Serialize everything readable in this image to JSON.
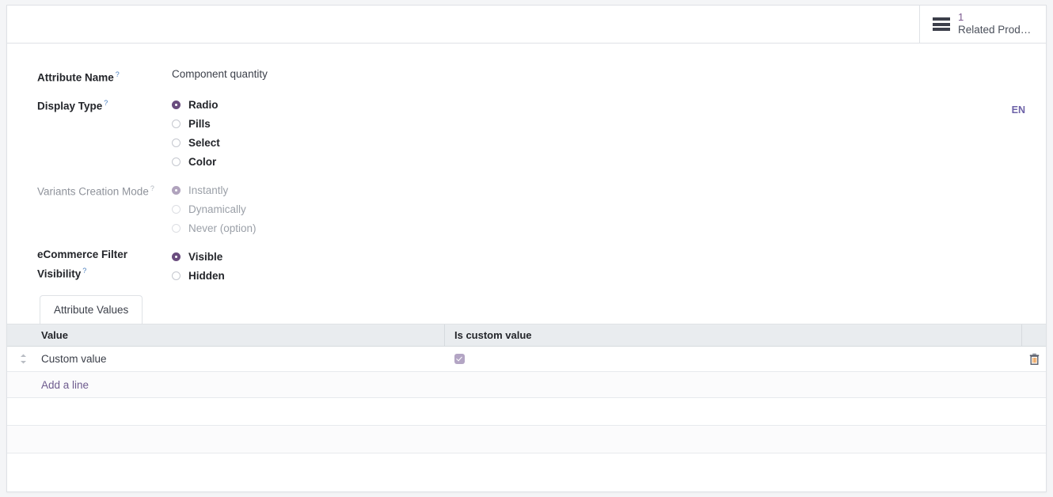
{
  "statusbar": {
    "related_products_button": {
      "icon": "hamburger-list-icon",
      "count": "1",
      "label": "Related Prod…"
    }
  },
  "form": {
    "attribute_name": {
      "label": "Attribute Name",
      "help_marker": "?",
      "value": "Component quantity"
    },
    "language_badge": "EN",
    "display_type": {
      "label": "Display Type",
      "help_marker": "?",
      "selected": "Radio",
      "options": [
        {
          "label": "Radio",
          "checked": true
        },
        {
          "label": "Pills",
          "checked": false
        },
        {
          "label": "Select",
          "checked": false
        },
        {
          "label": "Color",
          "checked": false
        }
      ]
    },
    "variants_creation_mode": {
      "label": "Variants Creation Mode",
      "help_marker": "?",
      "disabled": true,
      "selected": "Instantly",
      "options": [
        {
          "label": "Instantly",
          "checked": true
        },
        {
          "label": "Dynamically",
          "checked": false
        },
        {
          "label": "Never (option)",
          "checked": false
        }
      ]
    },
    "ecommerce_filter_visibility": {
      "label_line1": "eCommerce Filter",
      "label_line2": "Visibility",
      "help_marker": "?",
      "selected": "Visible",
      "options": [
        {
          "label": "Visible",
          "checked": true
        },
        {
          "label": "Hidden",
          "checked": false
        }
      ]
    }
  },
  "notebook": {
    "tabs": [
      {
        "label": "Attribute Values",
        "active": true
      }
    ]
  },
  "table": {
    "columns": [
      {
        "key": "handle",
        "label": ""
      },
      {
        "key": "value",
        "label": "Value"
      },
      {
        "key": "is_custom_value",
        "label": "Is custom value"
      },
      {
        "key": "actions",
        "label": ""
      }
    ],
    "rows": [
      {
        "handle_icon": "drag-handle-icon",
        "value": "Custom value",
        "is_custom_value": true,
        "delete_icon": "trash-icon"
      }
    ],
    "add_line_label": "Add a line"
  },
  "colors": {
    "accent_purple": "#6a4d7e",
    "link_purple": "#6e5b8e",
    "header_grey": "#e9ecef",
    "border_grey": "#dfe2e6",
    "text_dark": "#23252a",
    "text_muted": "#9ba0a8",
    "checkbox_lavender": "#b3a5c4",
    "help_blue": "#4a7fbf"
  }
}
